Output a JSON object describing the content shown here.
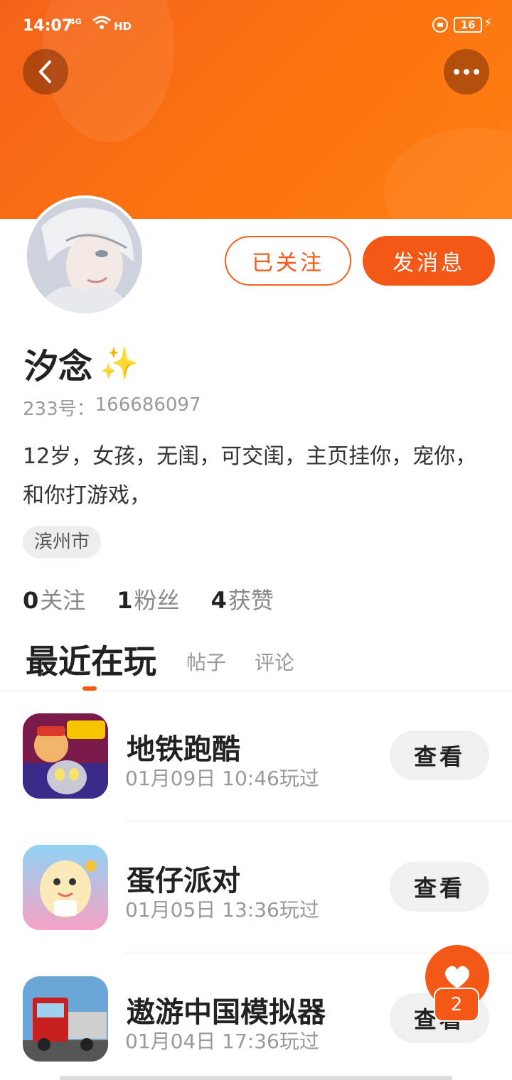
{
  "status_bar": {
    "time": "14:07",
    "signal": "4G",
    "hd": "HD",
    "battery": "16"
  },
  "header": {
    "back_icon": "chevron-left-icon",
    "more_icon": "more-horizontal-icon"
  },
  "profile": {
    "name": "汐念",
    "name_emoji": "✨",
    "id_label": "233号：",
    "id_value": "166686097",
    "bio": "12岁，女孩，无闺，可交闺，主页挂你，宠你，和你打游戏，",
    "location": "滨州市",
    "follow_button": "已关注",
    "message_button": "发消息"
  },
  "stats": [
    {
      "num": "0",
      "label": "关注"
    },
    {
      "num": "1",
      "label": "粉丝"
    },
    {
      "num": "4",
      "label": "获赞"
    }
  ],
  "tabs": {
    "active": "最近在玩",
    "posts": "帖子",
    "comments": "评论"
  },
  "games": [
    {
      "name": "地铁跑酷",
      "time": "01月09日 10:46玩过",
      "button": "查看"
    },
    {
      "name": "蛋仔派对",
      "time": "01月05日 13:36玩过",
      "button": "查看"
    },
    {
      "name": "遨游中国模拟器",
      "time": "01月04日 17:36玩过",
      "button": "查看"
    }
  ],
  "fab": {
    "icon": "heart-icon",
    "badge": "2"
  },
  "colors": {
    "accent": "#f45817",
    "header_start": "#f4621a",
    "header_end": "#ff7e12"
  }
}
